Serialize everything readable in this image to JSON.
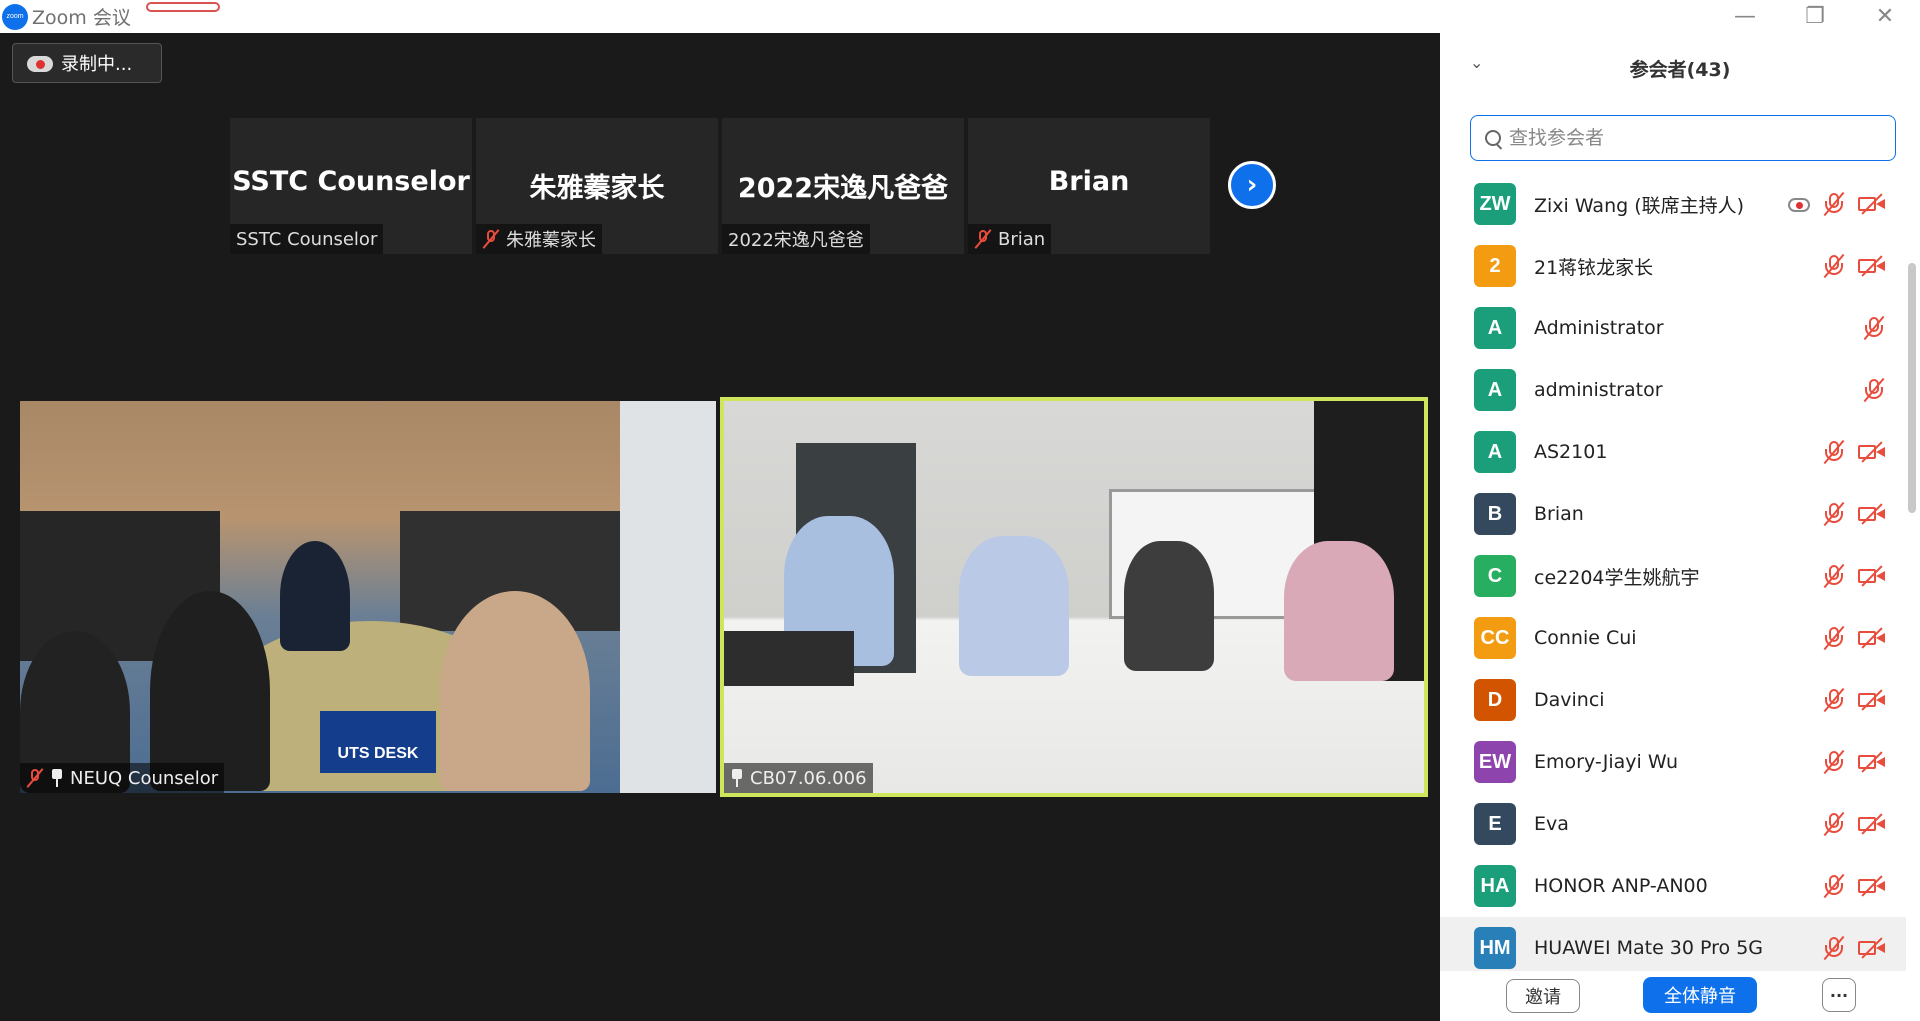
{
  "window": {
    "title": "Zoom 会议",
    "app_icon_text": "zoom",
    "minimize_glyph": "—",
    "maximize_glyph": "❐",
    "close_glyph": "✕"
  },
  "recording": {
    "label": "录制中..."
  },
  "thumbnails": [
    {
      "big": "SSTC Counselor",
      "label": "SSTC Counselor",
      "muted": false
    },
    {
      "big": "朱雅蓁家长",
      "label": "朱雅蓁家长",
      "muted": true
    },
    {
      "big": "2022宋逸凡爸爸",
      "label": "2022宋逸凡爸爸",
      "muted": false
    },
    {
      "big": "Brian",
      "label": "Brian",
      "muted": true
    }
  ],
  "next_glyph": "›",
  "videos": {
    "left": {
      "label": "NEUQ Counselor",
      "sign": "UTS DESK"
    },
    "right": {
      "label": "CB07.06.006",
      "highlight_color": "#cde65c"
    }
  },
  "panel": {
    "collapse_glyph": "⌄",
    "title": "参会者(43)",
    "search_placeholder": "查找参会者",
    "participants": [
      {
        "initials": "ZW",
        "name": "Zixi Wang (联席主持人)",
        "color": "#1a9f7a",
        "rec": true,
        "mic_off": true,
        "cam_off": true
      },
      {
        "initials": "2",
        "name": "21蒋铱龙家长",
        "color": "#f39c12",
        "rec": false,
        "mic_off": true,
        "cam_off": true
      },
      {
        "initials": "A",
        "name": "Administrator",
        "color": "#1a9f7a",
        "rec": false,
        "mic_off": true,
        "cam_off": false
      },
      {
        "initials": "A",
        "name": "administrator",
        "color": "#1a9f7a",
        "rec": false,
        "mic_off": true,
        "cam_off": false
      },
      {
        "initials": "A",
        "name": "AS2101",
        "color": "#1a9f7a",
        "rec": false,
        "mic_off": true,
        "cam_off": true
      },
      {
        "initials": "B",
        "name": "Brian",
        "color": "#34495e",
        "rec": false,
        "mic_off": true,
        "cam_off": true
      },
      {
        "initials": "C",
        "name": "ce2204学生姚航宇",
        "color": "#27ae60",
        "rec": false,
        "mic_off": true,
        "cam_off": true
      },
      {
        "initials": "CC",
        "name": "Connie Cui",
        "color": "#f39c12",
        "rec": false,
        "mic_off": true,
        "cam_off": true
      },
      {
        "initials": "D",
        "name": "Davinci",
        "color": "#d35400",
        "rec": false,
        "mic_off": true,
        "cam_off": true
      },
      {
        "initials": "EW",
        "name": "Emory-Jiayi Wu",
        "color": "#8e44ad",
        "rec": false,
        "mic_off": true,
        "cam_off": true
      },
      {
        "initials": "E",
        "name": "Eva",
        "color": "#34495e",
        "rec": false,
        "mic_off": true,
        "cam_off": true
      },
      {
        "initials": "HA",
        "name": "HONOR ANP-AN00",
        "color": "#1a9f7a",
        "rec": false,
        "mic_off": true,
        "cam_off": true
      },
      {
        "initials": "HM",
        "name": "HUAWEI Mate 30 Pro 5G",
        "color": "#2980b9",
        "rec": false,
        "mic_off": true,
        "cam_off": true
      }
    ],
    "invite_label": "邀请",
    "mute_all_label": "全体静音",
    "more_label": "···"
  }
}
